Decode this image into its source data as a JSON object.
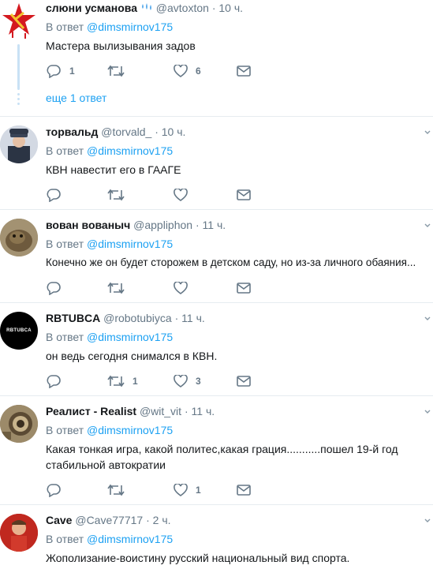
{
  "tweets": [
    {
      "name": "слюни усманова",
      "handle": "@avtoxton",
      "sep": "·",
      "time": "10 ч.",
      "reply_prefix": "В ответ",
      "reply_to": "@dimsmirnov175",
      "text": "Мастера вылизывания задов",
      "replies": "1",
      "retweets": "",
      "likes": "6",
      "more_replies": "еще 1 ответ"
    },
    {
      "name": "торвальд",
      "handle": "@torvald_",
      "sep": "·",
      "time": "10 ч.",
      "reply_prefix": "В ответ",
      "reply_to": "@dimsmirnov175",
      "text": "КВН навестит его в ГААГЕ",
      "replies": "",
      "retweets": "",
      "likes": ""
    },
    {
      "name": "вован вованыч",
      "handle": "@appliphon",
      "sep": "·",
      "time": "11 ч.",
      "reply_prefix": "В ответ",
      "reply_to": "@dimsmirnov175",
      "text": "Конечно же он будет сторожем в детском саду, но из-за личного обаяния...",
      "replies": "",
      "retweets": "",
      "likes": ""
    },
    {
      "name": "RBTUBCA",
      "handle": "@robotubiyca",
      "sep": "·",
      "time": "11 ч.",
      "reply_prefix": "В ответ",
      "reply_to": "@dimsmirnov175",
      "text": "он ведь сегодня снимался в КВН.",
      "replies": "",
      "retweets": "1",
      "likes": "3",
      "avatar_text": "RBTUBCA"
    },
    {
      "name": "Реалист - Realist",
      "handle": "@wit_vit",
      "sep": "·",
      "time": "11 ч.",
      "reply_prefix": "В ответ",
      "reply_to": "@dimsmirnov175",
      "text": "Какая тонкая игра, какой политес,какая грация...........пошел 19-й год стабильной автократии",
      "replies": "",
      "retweets": "",
      "likes": "1"
    },
    {
      "name": "Cave",
      "handle": "@Cave77717",
      "sep": "·",
      "time": "2 ч.",
      "reply_prefix": "В ответ",
      "reply_to": "@dimsmirnov175",
      "text": "Жополизание-воистину русский национальный вид спорта.",
      "replies": "",
      "retweets": "",
      "likes": ""
    }
  ]
}
